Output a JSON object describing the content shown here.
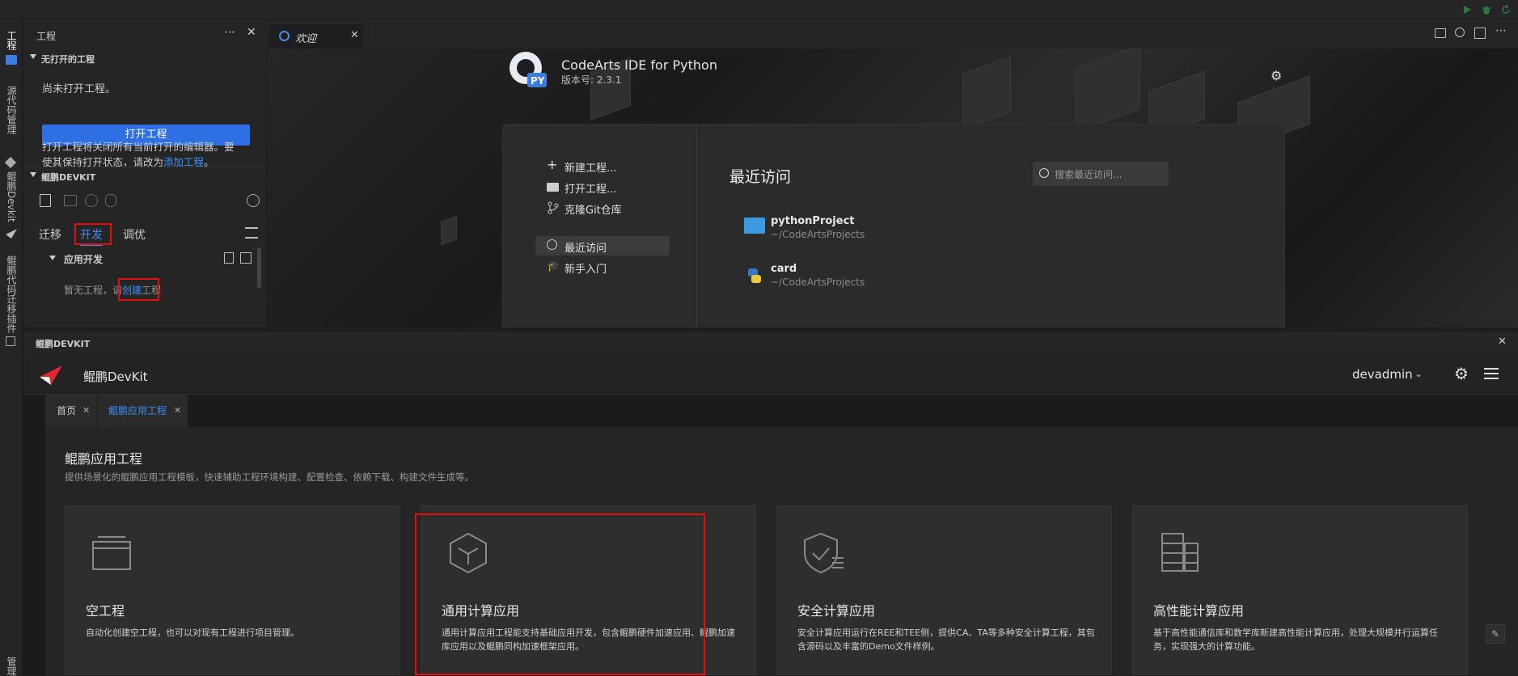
{
  "sidebar": {
    "title": "工程",
    "no_project_section": "无打开的工程",
    "no_project_text": "尚未打开工程。",
    "open_project_btn": "打开工程",
    "note_line1": "打开工程将关闭所有当前打开的编辑器。要",
    "note_line2": "使其保持打开状态，请改为",
    "note_link": "添加工程",
    "note_end": "。",
    "devkit_section": "鲲鹏DEVKIT",
    "tabs": [
      "迁移",
      "开发",
      "调优"
    ],
    "app_dev": "应用开发",
    "empty_prefix": "暂无工程，请",
    "empty_link": "创建",
    "empty_suffix": "工程"
  },
  "activity": {
    "project": "工程",
    "scm": "源代码管理",
    "devkit": "鲲鹏Devkit",
    "migrate": "鲲鹏代码迁移插件",
    "bottom": "管理"
  },
  "editor": {
    "tab_label": "欢迎",
    "app_name": "CodeArts IDE for Python",
    "version": "版本号: 2.3.1",
    "menu": {
      "new": "新建工程...",
      "open": "打开工程...",
      "clone": "克隆Git仓库",
      "recent": "最近访问",
      "start": "新手入门"
    },
    "recent_title": "最近访问",
    "search_placeholder": "搜索最近访问...",
    "recent_items": [
      {
        "name": "pythonProject",
        "path": "~/CodeArtsProjects"
      },
      {
        "name": "card",
        "path": "~/CodeArtsProjects"
      }
    ]
  },
  "devkit_panel": {
    "header": "鲲鹏DEVKIT",
    "brand": "鲲鹏DevKit",
    "user": "devadmin",
    "tabs": [
      "首页",
      "鲲鹏应用工程"
    ],
    "page_title": "鲲鹏应用工程",
    "page_desc": "提供场景化的鲲鹏应用工程模板，快速辅助工程环境构建、配置检查、依赖下载、构建文件生成等。",
    "cards": [
      {
        "title": "空工程",
        "desc": "自动化创建空工程，也可以对现有工程进行项目管理。",
        "icon": "window-icon"
      },
      {
        "title": "通用计算应用",
        "desc": "通用计算应用工程能支持基础应用开发，包含鲲鹏硬件加速应用、鲲鹏加速库应用以及鲲鹏同构加速框架应用。",
        "icon": "cube-icon"
      },
      {
        "title": "安全计算应用",
        "desc": "安全计算应用运行在REE和TEE侧，提供CA、TA等多种安全计算工程，其包含源码以及丰富的Demo文件样例。",
        "icon": "shield-check-icon"
      },
      {
        "title": "高性能计算应用",
        "desc": "基于高性能通信库和数学库新建高性能计算应用，处理大规模并行运算任务，实现强大的计算功能。",
        "icon": "server-icon"
      }
    ]
  },
  "colors": {
    "accent": "#2f6fe4",
    "link": "#3794ff",
    "highlight": "#e01010"
  }
}
